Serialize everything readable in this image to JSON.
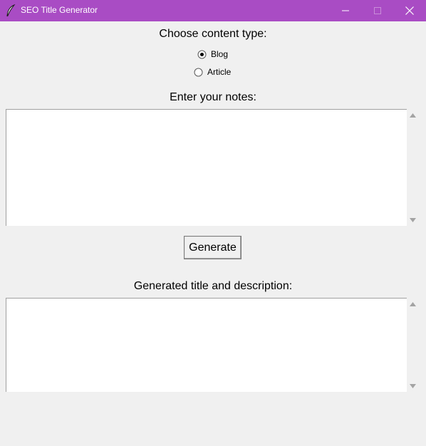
{
  "window": {
    "title": "SEO Title Generator",
    "titlebar_color": "#a94cc4",
    "icon": "feather-icon"
  },
  "content_type": {
    "label": "Choose content type:",
    "options": [
      {
        "label": "Blog",
        "selected": true
      },
      {
        "label": "Article",
        "selected": false
      }
    ]
  },
  "notes": {
    "label": "Enter your notes:",
    "value": ""
  },
  "generate_button": {
    "label": "Generate"
  },
  "output": {
    "label": "Generated title and description:",
    "value": ""
  }
}
